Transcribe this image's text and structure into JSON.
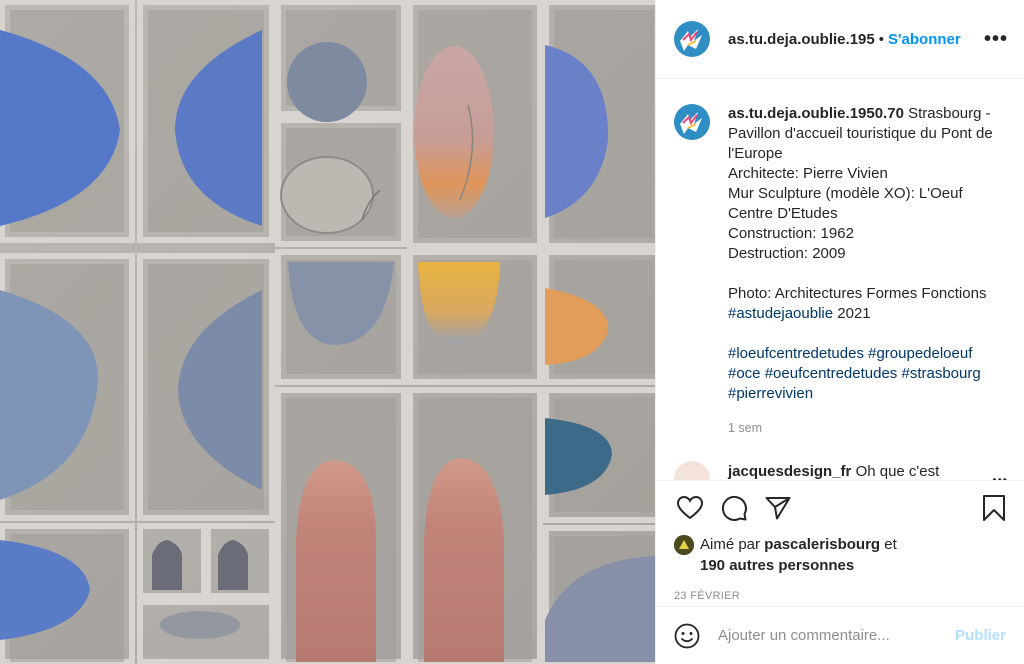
{
  "post": {
    "username_truncated": "as.tu.deja.oublie.195",
    "separator": "•",
    "follow_label": "S'abonner",
    "more_label": "•••"
  },
  "caption": {
    "username": "as.tu.deja.oublie.1950.70",
    "text_lines": "Strasbourg - Pavillon d'accueil touristique du Pont de l'Europe\nArchitecte: Pierre Vivien\nMur Sculpture (modèle XO): L'Oeuf Centre D'Etudes\nConstruction: 1962\nDestruction: 2009\n\nPhoto: Architectures Formes Fonctions ",
    "inline_tag": "#astudejaoublie",
    "after_tag": " 2021",
    "hashtags": [
      "#loeufcentredetudes",
      "#groupedeloeuf",
      "#oce",
      "#oeufcentredetudes",
      "#strasbourg",
      "#pierrevivien"
    ],
    "time": "1 sem"
  },
  "next_comment": {
    "username": "jacquesdesign_fr",
    "text": "Oh que c'est",
    "more": "•••"
  },
  "actions": {
    "like_icon": "heart-icon",
    "comment_icon": "comment-bubble-icon",
    "share_icon": "paper-plane-icon",
    "save_icon": "bookmark-icon"
  },
  "likes": {
    "prefix": "Aimé par ",
    "user": "pascalerisbourg",
    "mid": " et",
    "others": "190 autres personnes"
  },
  "date": "23 FÉVRIER",
  "comment_box": {
    "placeholder": "Ajouter un commentaire...",
    "publish_label": "Publier",
    "emoji_icon": "smiley-icon"
  },
  "colors": {
    "accent": "#0095f6",
    "hashtag": "#00376b",
    "publish_disabled": "#b2dffc",
    "muted": "#8e8e8e"
  }
}
